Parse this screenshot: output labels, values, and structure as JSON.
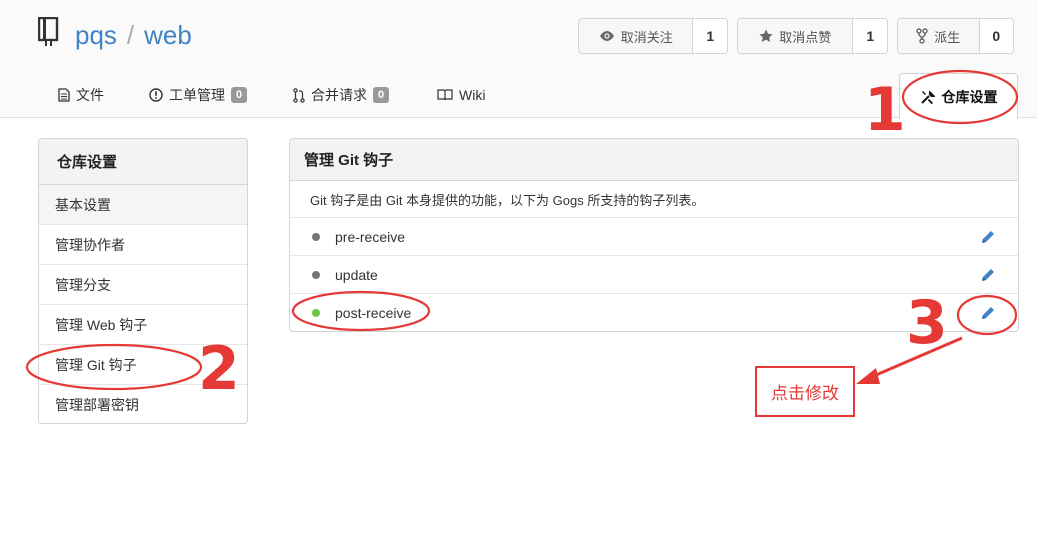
{
  "repo": {
    "owner": "pqs",
    "separator": "/",
    "name": "web"
  },
  "actions": {
    "unwatch": {
      "label": "取消关注",
      "count": "1"
    },
    "unstar": {
      "label": "取消点赞",
      "count": "1"
    },
    "fork": {
      "label": "派生",
      "count": "0"
    }
  },
  "tabs": [
    {
      "label": "文件"
    },
    {
      "label": "工单管理",
      "badge": "0"
    },
    {
      "label": "合并请求",
      "badge": "0"
    },
    {
      "label": "Wiki"
    }
  ],
  "active_tab": {
    "label": "仓库设置"
  },
  "sidebar": {
    "title": "仓库设置",
    "items": [
      {
        "label": "基本设置"
      },
      {
        "label": "管理协作者"
      },
      {
        "label": "管理分支"
      },
      {
        "label": "管理 Web 钩子"
      },
      {
        "label": "管理 Git 钩子"
      },
      {
        "label": "管理部署密钥"
      }
    ]
  },
  "panel": {
    "title": "管理 Git 钩子",
    "description": "Git 钩子是由 Git 本身提供的功能，以下为 Gogs 所支持的钩子列表。",
    "hooks": [
      {
        "name": "pre-receive",
        "status_color": "#767676"
      },
      {
        "name": "update",
        "status_color": "#767676"
      },
      {
        "name": "post-receive",
        "status_color": "#6cc644"
      }
    ]
  },
  "annotations": {
    "step1": "1",
    "step2": "2",
    "step3": "3",
    "callout": "点击修改",
    "color": "#e53935"
  },
  "colors": {
    "link": "#4183c4",
    "edit_icon": "#4183c4"
  }
}
